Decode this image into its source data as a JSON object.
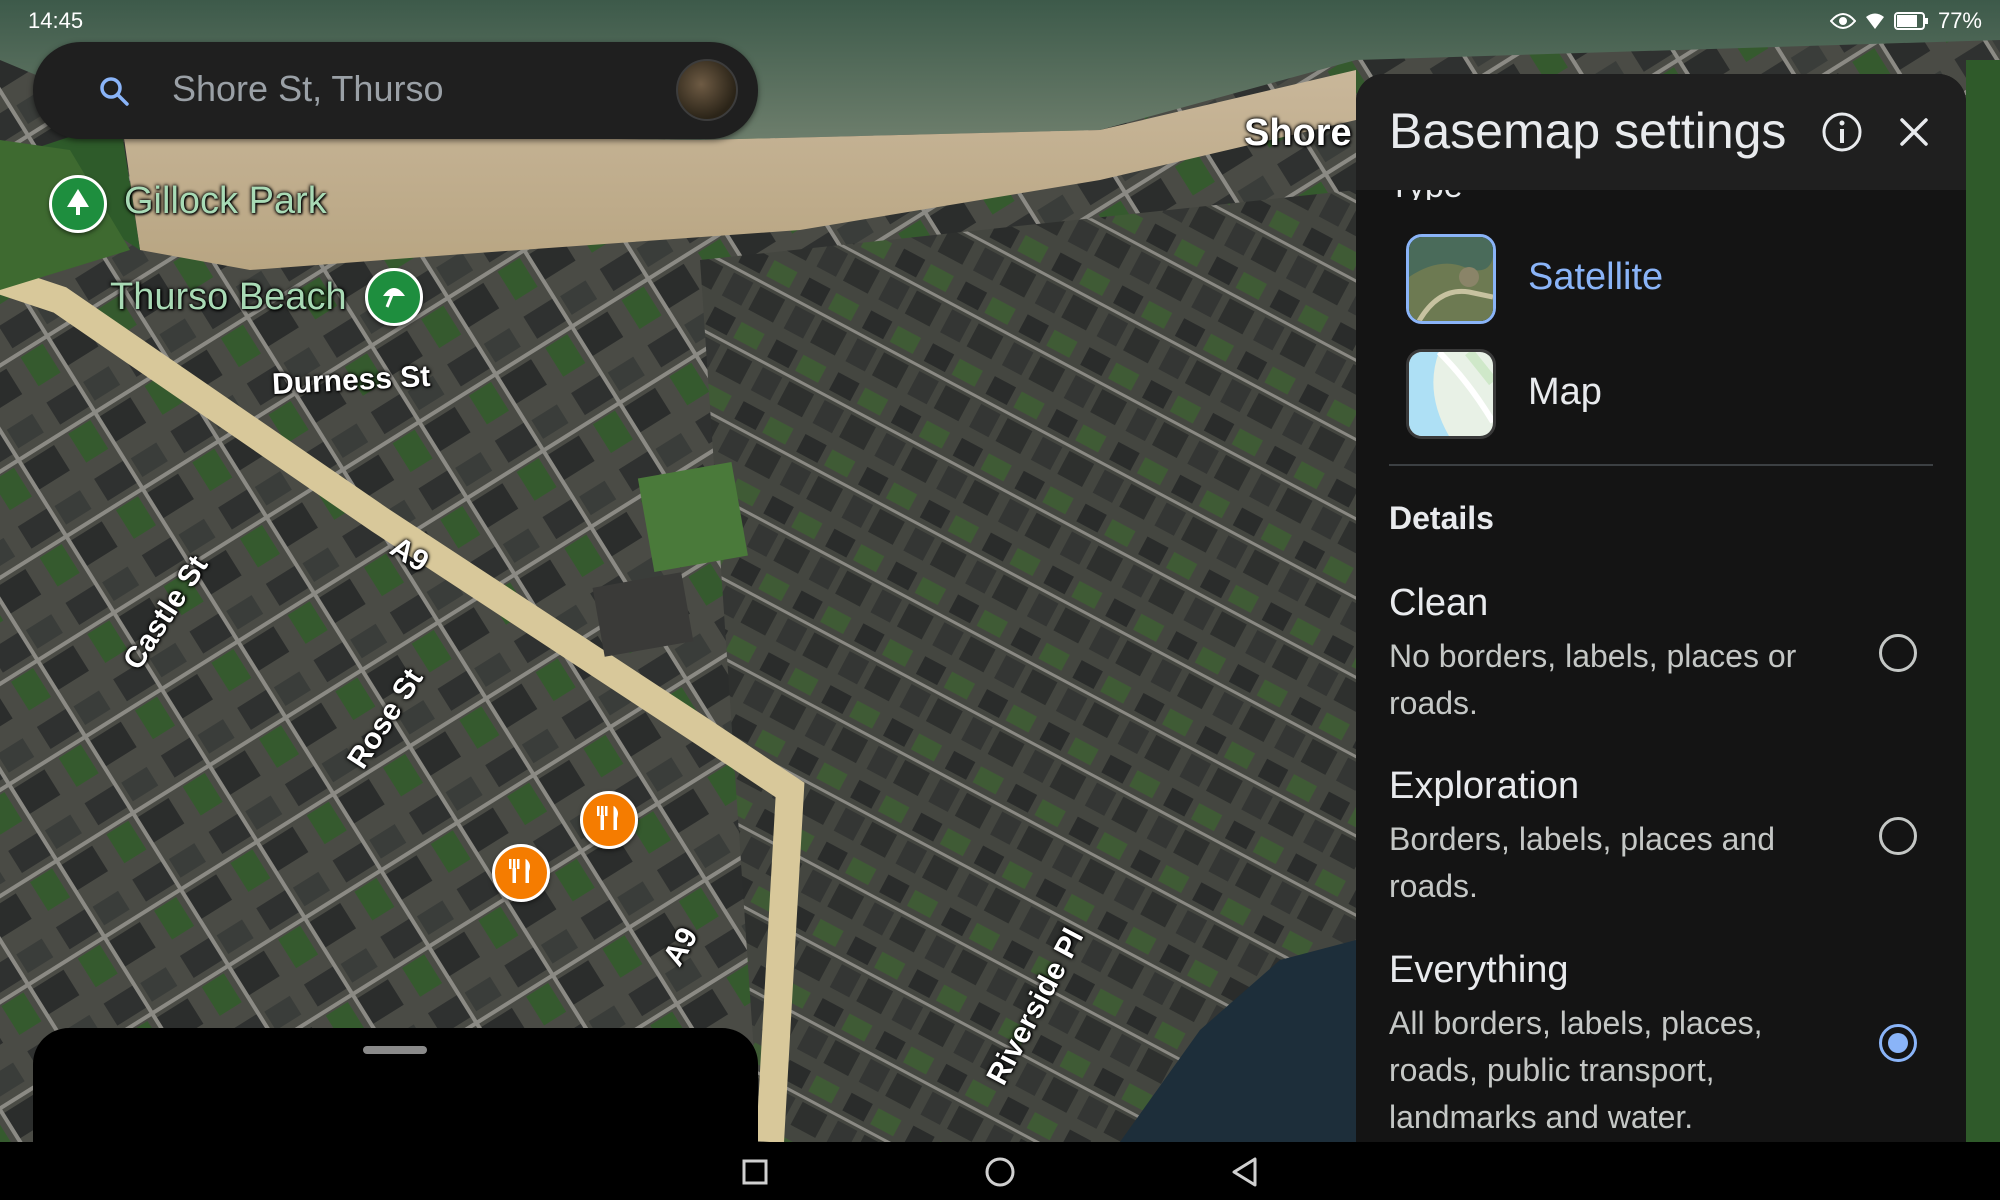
{
  "status_bar": {
    "time": "14:45",
    "battery": "77%"
  },
  "search": {
    "text": "Shore St, Thurso"
  },
  "map": {
    "poi_labels": {
      "gillock_park": "Gillock Park",
      "thurso_beach": "Thurso Beach"
    },
    "road_labels": {
      "durness_st": "Durness St",
      "a9_north": "A9",
      "a9_south": "A9",
      "castle_st": "Castle St",
      "rose_st": "Rose St",
      "riverside_pl": "Riverside Pl",
      "shore": "Shore"
    }
  },
  "panel": {
    "title": "Basemap settings",
    "type_section": "Type",
    "types": [
      {
        "label": "Satellite",
        "selected": true
      },
      {
        "label": "Map",
        "selected": false
      }
    ],
    "details_heading": "Details",
    "details": [
      {
        "title": "Clean",
        "description": "No borders, labels, places or roads.",
        "checked": false
      },
      {
        "title": "Exploration",
        "description": "Borders, labels, places and roads.",
        "checked": false
      },
      {
        "title": "Everything",
        "description": "All borders, labels, places, roads, public transport, landmarks and water.",
        "checked": true
      }
    ]
  },
  "icons": {
    "search": "search-icon",
    "info": "info-icon",
    "close": "close-icon",
    "park": "tree-icon",
    "beach": "umbrella-icon",
    "restaurant": "fork-knife-icon",
    "nav_recents": "square-icon",
    "nav_home": "circle-icon",
    "nav_back": "triangle-back-icon"
  }
}
